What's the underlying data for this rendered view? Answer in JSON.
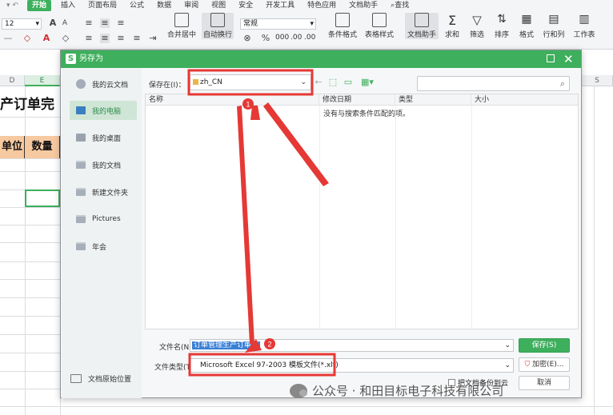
{
  "menu": {
    "tabs": [
      "开始",
      "插入",
      "页面布局",
      "公式",
      "数据",
      "审阅",
      "视图",
      "安全",
      "开发工具",
      "特色应用",
      "文档助手"
    ],
    "search": "查找"
  },
  "ribbon": {
    "font_size": "12",
    "number_format": "常规",
    "merge_center": "合并居中",
    "wrap_text": "自动换行",
    "conditional_format": "条件格式",
    "table_style": "表格样式",
    "doc_assistant": "文档助手",
    "sum": "求和",
    "filter": "筛选",
    "sort": "排序",
    "format": "格式",
    "rows_cols": "行和列",
    "worksheet": "工作表",
    "percent": "%",
    "thousands": "000",
    "decimal_inc": ".00",
    "decimal_dec": ".00"
  },
  "sheet": {
    "columns": [
      "D",
      "E",
      "",
      "S"
    ],
    "title_fragment": "产订单完",
    "header_cells": [
      "单位",
      "数量"
    ]
  },
  "dialog": {
    "title": "另存为",
    "logo": "S",
    "sidebar": [
      {
        "label": "我的云文档",
        "icon": "cloud-icon"
      },
      {
        "label": "我的电脑",
        "icon": "computer-icon"
      },
      {
        "label": "我的桌面",
        "icon": "desktop-icon"
      },
      {
        "label": "我的文档",
        "icon": "folder-icon"
      },
      {
        "label": "新建文件夹",
        "icon": "folder-icon"
      },
      {
        "label": "Pictures",
        "icon": "folder-icon"
      },
      {
        "label": "年会",
        "icon": "folder-icon"
      }
    ],
    "sidebar_bottom": "文档原始位置",
    "save_in_label": "保存在(I)：",
    "save_in_value": "zh_CN",
    "columns": [
      "名称",
      "修改日期",
      "类型",
      "大小"
    ],
    "empty_message": "没有与搜索条件匹配的项。",
    "filename_label": "文件名(N)：",
    "filename_value": "订单管理生产订单完",
    "filetype_label": "文件类型(T)：",
    "filetype_value": "Microsoft Excel 97-2003 模板文件(*.xlt)",
    "save_button": "保存(S)",
    "encrypt_button": "加密(E)...",
    "cancel_button": "取消",
    "backup_checkbox": "把文档备份到云"
  },
  "annotations": {
    "marker_1": "1",
    "marker_2": "2",
    "color": "#e53935"
  },
  "watermark": "公众号 · 和田目标电子科技有限公司",
  "colors": {
    "accent": "#3eaf5c",
    "annotation_red": "#e53935",
    "header_fill": "#f7c9a0"
  }
}
